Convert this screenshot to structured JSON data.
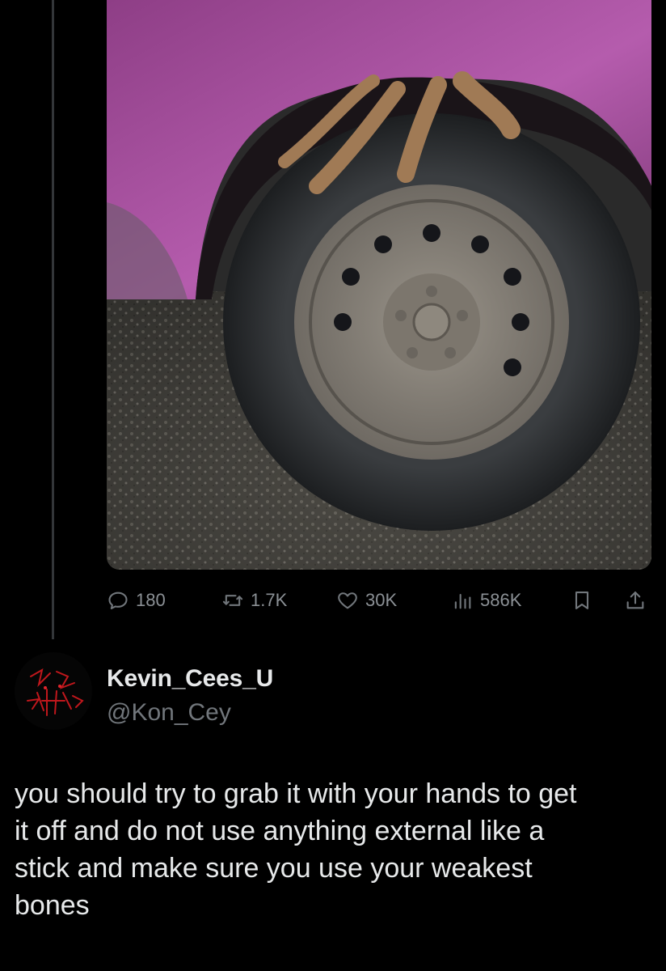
{
  "original_tweet": {
    "actions": {
      "reply": {
        "icon": "reply-icon",
        "count": "180"
      },
      "retweet": {
        "icon": "retweet-icon",
        "count": "1.7K"
      },
      "like": {
        "icon": "heart-icon",
        "count": "30K"
      },
      "views": {
        "icon": "views-icon",
        "count": "586K"
      },
      "bookmark": {
        "icon": "bookmark-icon"
      },
      "share": {
        "icon": "share-icon"
      }
    }
  },
  "reply": {
    "author": {
      "display_name": "Kevin_Cees_U",
      "handle": "@Kon_Cey"
    },
    "text": "you should try to grab it with your hands to get\nit off and do not use anything external like a\nstick and make sure you use your weakest\nbones"
  },
  "colors": {
    "background": "#000000",
    "text_primary": "#e7e9ea",
    "text_secondary": "#71767b",
    "thread_line": "#333639"
  }
}
